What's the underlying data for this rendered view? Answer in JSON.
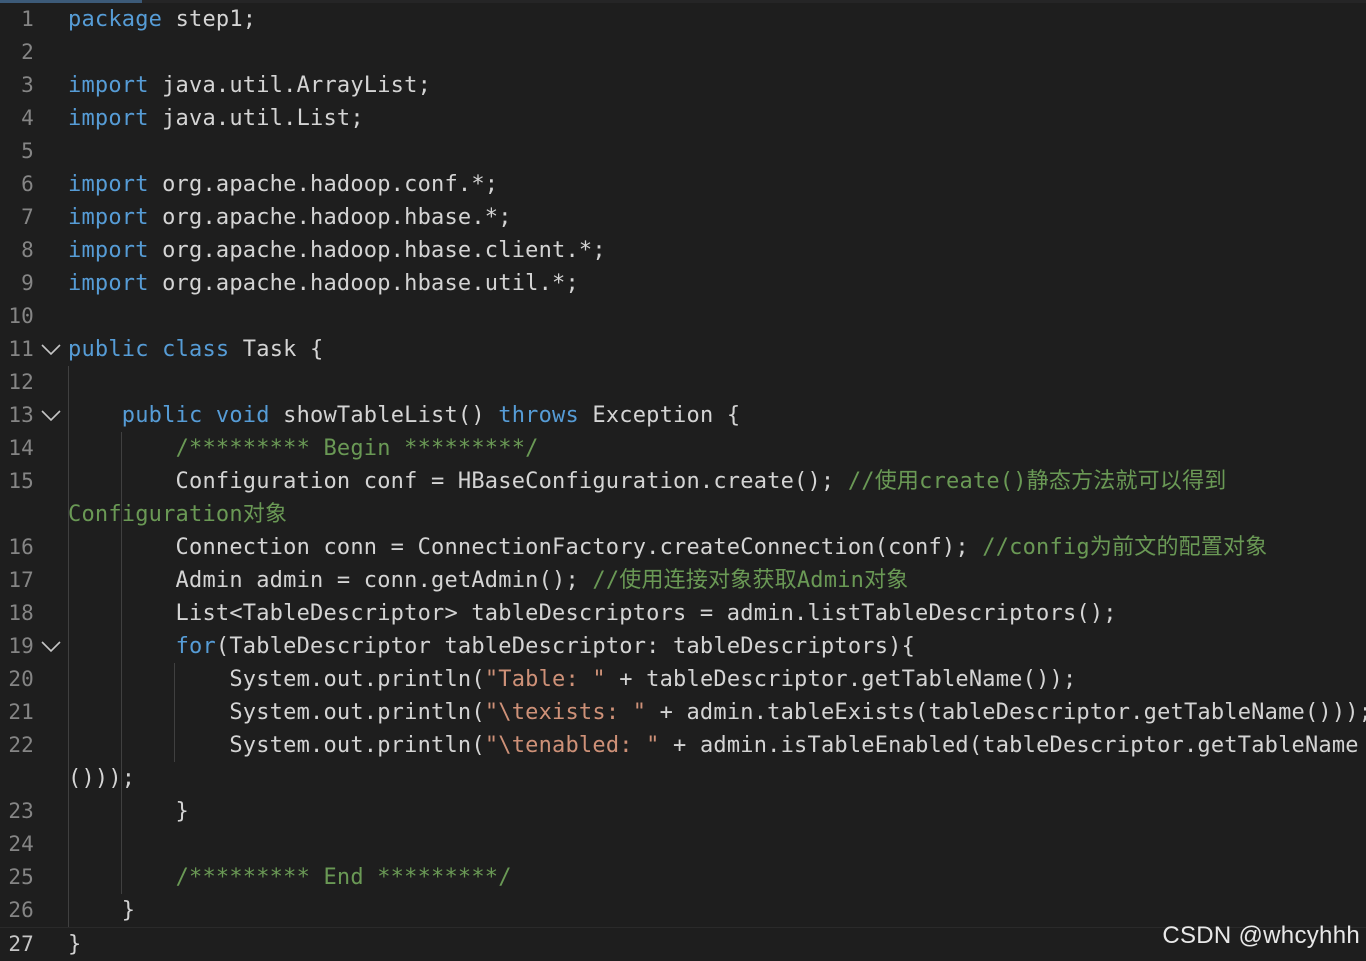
{
  "editor": {
    "lines": [
      {
        "num": "1",
        "segments": [
          {
            "t": "package",
            "c": "kw"
          },
          {
            "t": " step1;",
            "c": ""
          }
        ]
      },
      {
        "num": "2",
        "segments": []
      },
      {
        "num": "3",
        "segments": [
          {
            "t": "import",
            "c": "kw"
          },
          {
            "t": " java.util.ArrayList;",
            "c": ""
          }
        ]
      },
      {
        "num": "4",
        "segments": [
          {
            "t": "import",
            "c": "kw"
          },
          {
            "t": " java.util.List;",
            "c": ""
          }
        ]
      },
      {
        "num": "5",
        "segments": []
      },
      {
        "num": "6",
        "segments": [
          {
            "t": "import",
            "c": "kw"
          },
          {
            "t": " org.apache.hadoop.conf.*;",
            "c": ""
          }
        ]
      },
      {
        "num": "7",
        "segments": [
          {
            "t": "import",
            "c": "kw"
          },
          {
            "t": " org.apache.hadoop.hbase.*;",
            "c": ""
          }
        ]
      },
      {
        "num": "8",
        "segments": [
          {
            "t": "import",
            "c": "kw"
          },
          {
            "t": " org.apache.hadoop.hbase.client.*;",
            "c": ""
          }
        ]
      },
      {
        "num": "9",
        "segments": [
          {
            "t": "import",
            "c": "kw"
          },
          {
            "t": " org.apache.hadoop.hbase.util.*;",
            "c": ""
          }
        ]
      },
      {
        "num": "10",
        "segments": []
      },
      {
        "num": "11",
        "fold": true,
        "segments": [
          {
            "t": "public",
            "c": "kw"
          },
          {
            "t": " ",
            "c": ""
          },
          {
            "t": "class",
            "c": "kw"
          },
          {
            "t": " Task {",
            "c": ""
          }
        ]
      },
      {
        "num": "12",
        "segments": []
      },
      {
        "num": "13",
        "fold": true,
        "segments": [
          {
            "t": "    ",
            "c": ""
          },
          {
            "t": "public",
            "c": "kw"
          },
          {
            "t": " ",
            "c": ""
          },
          {
            "t": "void",
            "c": "kw"
          },
          {
            "t": " showTableList() ",
            "c": ""
          },
          {
            "t": "throws",
            "c": "kw"
          },
          {
            "t": " Exception {",
            "c": ""
          }
        ]
      },
      {
        "num": "14",
        "segments": [
          {
            "t": "        ",
            "c": ""
          },
          {
            "t": "/********* Begin *********/",
            "c": "cm"
          }
        ]
      },
      {
        "num": "15",
        "segments": [
          {
            "t": "        Configuration conf = HBaseConfiguration.create(); ",
            "c": ""
          },
          {
            "t": "//使用create()静态方法就可以得到",
            "c": "cm"
          }
        ]
      },
      {
        "num": "",
        "segments": [
          {
            "t": "Configuration对象",
            "c": "cm"
          }
        ]
      },
      {
        "num": "16",
        "segments": [
          {
            "t": "        Connection conn = ConnectionFactory.createConnection(conf); ",
            "c": ""
          },
          {
            "t": "//config为前文的配置对象",
            "c": "cm"
          }
        ]
      },
      {
        "num": "17",
        "segments": [
          {
            "t": "        Admin admin = conn.getAdmin(); ",
            "c": ""
          },
          {
            "t": "//使用连接对象获取Admin对象",
            "c": "cm"
          }
        ]
      },
      {
        "num": "18",
        "segments": [
          {
            "t": "        List<TableDescriptor> tableDescriptors = admin.listTableDescriptors();",
            "c": ""
          }
        ]
      },
      {
        "num": "19",
        "fold": true,
        "segments": [
          {
            "t": "        ",
            "c": ""
          },
          {
            "t": "for",
            "c": "kw"
          },
          {
            "t": "(TableDescriptor tableDescriptor: tableDescriptors){",
            "c": ""
          }
        ]
      },
      {
        "num": "20",
        "segments": [
          {
            "t": "            System.out.println(",
            "c": ""
          },
          {
            "t": "\"Table: \"",
            "c": "str"
          },
          {
            "t": " + tableDescriptor.getTableName());",
            "c": ""
          }
        ]
      },
      {
        "num": "21",
        "segments": [
          {
            "t": "            System.out.println(",
            "c": ""
          },
          {
            "t": "\"\\texists: \"",
            "c": "str"
          },
          {
            "t": " + admin.tableExists(tableDescriptor.getTableName()));",
            "c": ""
          }
        ]
      },
      {
        "num": "22",
        "segments": [
          {
            "t": "            System.out.println(",
            "c": ""
          },
          {
            "t": "\"\\tenabled: \"",
            "c": "str"
          },
          {
            "t": " + admin.isTableEnabled(tableDescriptor.getTableName",
            "c": ""
          }
        ]
      },
      {
        "num": "",
        "segments": [
          {
            "t": "()));",
            "c": ""
          }
        ]
      },
      {
        "num": "23",
        "segments": [
          {
            "t": "        }",
            "c": ""
          }
        ]
      },
      {
        "num": "24",
        "segments": []
      },
      {
        "num": "25",
        "segments": [
          {
            "t": "        ",
            "c": ""
          },
          {
            "t": "/********* End *********/",
            "c": "cm"
          }
        ]
      },
      {
        "num": "26",
        "segments": [
          {
            "t": "    }",
            "c": ""
          }
        ]
      },
      {
        "num": "27",
        "active": true,
        "segments": [
          {
            "t": "}",
            "c": ""
          }
        ]
      }
    ]
  },
  "watermark": {
    "text": "CSDN @whcyhhh"
  },
  "colors": {
    "background": "#1e1e1e",
    "keyword": "#569cd6",
    "comment": "#6a9955",
    "string": "#ce9178",
    "text": "#d4d4d4",
    "line_number": "#858585"
  }
}
